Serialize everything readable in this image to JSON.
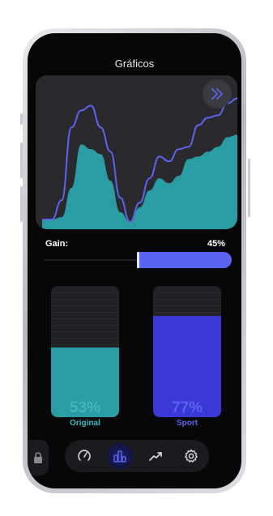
{
  "header": {
    "title": "Gráficos"
  },
  "chart_data": {
    "type": "area",
    "x": [
      0,
      1,
      2,
      3,
      4,
      5,
      6,
      7,
      8,
      9,
      10,
      11,
      12,
      13,
      14,
      15,
      16,
      17,
      18,
      19,
      20
    ],
    "series": [
      {
        "values": [
          4,
          4,
          6,
          30,
          66,
          62,
          58,
          36,
          10,
          2,
          14,
          28,
          38,
          34,
          40,
          54,
          56,
          60,
          64,
          72,
          74
        ]
      },
      {
        "values": [
          4,
          4,
          20,
          80,
          94,
          98,
          80,
          60,
          22,
          2,
          18,
          38,
          56,
          52,
          62,
          64,
          82,
          88,
          90,
          100,
          104
        ]
      }
    ],
    "ylim": [
      0,
      115
    ],
    "colors": {
      "area": "#2a9ca3",
      "line": "#5c63ee",
      "background": "#2a2a2e"
    }
  },
  "chart_controls": {
    "fast_forward_icon": "chevrons-right-icon",
    "accent": "#5c63ee"
  },
  "gain": {
    "label": "Gain:",
    "value_text": "45%",
    "level": 0.45
  },
  "cards": [
    {
      "label": "Original",
      "percent_text": "53%",
      "level": 0.53,
      "color": "#2a9ca3",
      "text_color": "#3fb8bf"
    },
    {
      "label": "Sport",
      "percent_text": "77%",
      "level": 0.77,
      "color": "#3a38d6",
      "text_color": "#5c63ee"
    }
  ],
  "dock": {
    "lock_icon": "lock-icon",
    "items": [
      {
        "icon": "gauge-icon",
        "active": false
      },
      {
        "icon": "bar-chart-icon",
        "active": true
      },
      {
        "icon": "trend-line-icon",
        "active": false
      },
      {
        "icon": "gear-icon",
        "active": false
      }
    ]
  }
}
